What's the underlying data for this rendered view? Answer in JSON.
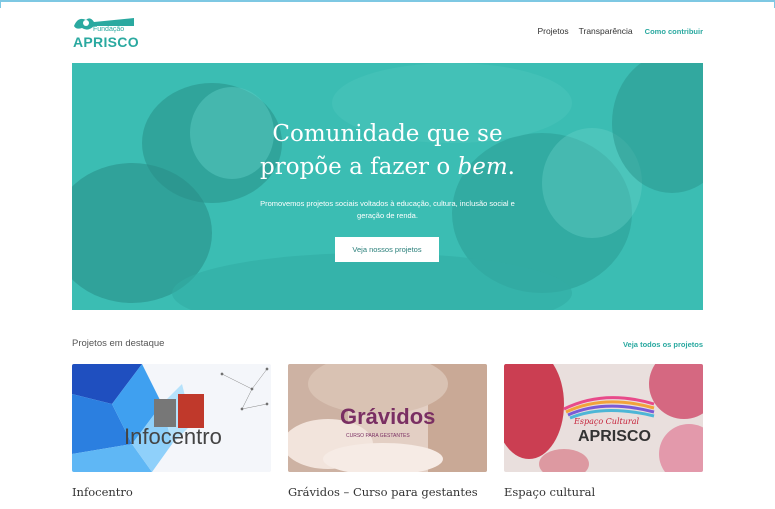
{
  "header": {
    "logo": {
      "small": "Fundação",
      "name": "APRISCO"
    },
    "nav": [
      {
        "label": "Projetos"
      },
      {
        "label": "Transparência"
      },
      {
        "label": "Como contribuir"
      }
    ]
  },
  "hero": {
    "title_line1": "Comunidade que se",
    "title_line2_pre": "propõe a fazer o ",
    "title_line2_em": "bem",
    "title_line2_post": ".",
    "subtitle": "Promovemos projetos sociais voltados à educação, cultura, inclusão social e geração de renda.",
    "button": "Veja nossos projetos"
  },
  "featured": {
    "title": "Projetos em destaque",
    "see_all": "Veja todos os projetos",
    "cards": [
      {
        "name": "Infocentro",
        "logo_text": "Infocentro"
      },
      {
        "name": "Grávidos – Curso para gestantes",
        "logo_text": "Grávidos",
        "logo_sub": "CURSO PARA GESTANTES"
      },
      {
        "name": "Espaço cultural",
        "logo_text": "APRISCO",
        "logo_script": "Espaço Cultural"
      }
    ]
  },
  "colors": {
    "accent": "#2aa9a0",
    "hero": "#3bbdb3"
  }
}
